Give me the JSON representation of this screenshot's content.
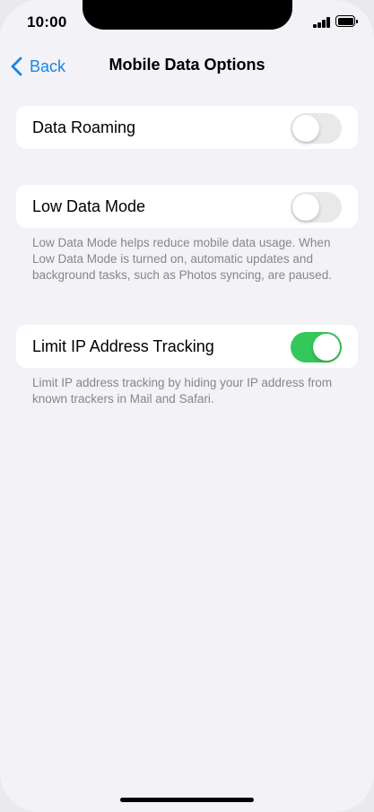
{
  "status_bar": {
    "time": "10:00",
    "signal_icon": "cellular-signal-icon",
    "battery_icon": "battery-icon"
  },
  "nav": {
    "back_label": "Back",
    "back_icon": "chevron-left-icon",
    "title": "Mobile Data Options",
    "accent_color": "#1a84e5"
  },
  "settings": [
    {
      "label": "Data Roaming",
      "enabled": false
    },
    {
      "label": "Low Data Mode",
      "enabled": false,
      "footnote": "Low Data Mode helps reduce mobile data usage. When Low Data Mode is turned on, automatic updates and background tasks, such as Photos syncing, are paused."
    },
    {
      "label": "Limit IP Address Tracking",
      "enabled": true,
      "footnote": "Limit IP address tracking by hiding your IP address from known trackers in Mail and Safari."
    }
  ],
  "colors": {
    "toggle_on": "#34c759",
    "toggle_off": "#e9e9ea",
    "background": "#f2f2f7"
  }
}
